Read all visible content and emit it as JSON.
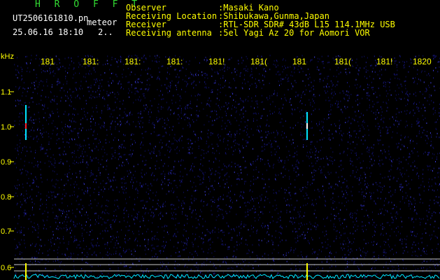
{
  "app": {
    "name": "H R O F F T"
  },
  "file": {
    "filename": "UT2506161810.pn",
    "mode": "meteor",
    "date_time": "25.06.16 18:10",
    "counter": "2.."
  },
  "header": {
    "rows": [
      {
        "label": "Observer",
        "value": ":Masaki Kano"
      },
      {
        "label": "Receiving Location",
        "value": ":Shibukawa,Gunma,Japan"
      },
      {
        "label": "Receiver",
        "value": ":RTL-SDR SDR# 43dB L15 114.1MHz USB"
      },
      {
        "label": "Receiving antenna",
        "value": ":5el Yagi Az 20 for Aomori VOR"
      }
    ]
  },
  "chart_data": {
    "type": "heatmap",
    "yunit": "kHz",
    "ylim": [
      0.58,
      1.18
    ],
    "y_ticks": [
      "1.1",
      "1.0",
      "0.9",
      "0.8",
      "0.7",
      "0.6"
    ],
    "time_ticks": [
      "181",
      "1812",
      "1813",
      "1814",
      "1815",
      "1816",
      "1817",
      "1818",
      "1819",
      "1820"
    ],
    "time_tick_display": [
      "181",
      "181:",
      "181:",
      "181:",
      "181!",
      "181(",
      "181",
      "181(",
      "181!",
      "1820"
    ],
    "events": [
      {
        "name": "meteor-echo-1",
        "time_min": 18.1,
        "freq_from": 0.96,
        "freq_to": 1.06,
        "peak": 1.0
      },
      {
        "name": "meteor-echo-2",
        "time_min": 18.17,
        "freq_from": 0.96,
        "freq_to": 1.04,
        "peak": 1.0
      }
    ],
    "colors": {
      "background": "#000000",
      "noise": "#1a1a8a",
      "signal": "#00e5ff",
      "peak": "#ff2020",
      "axis": "#ffff00"
    }
  }
}
